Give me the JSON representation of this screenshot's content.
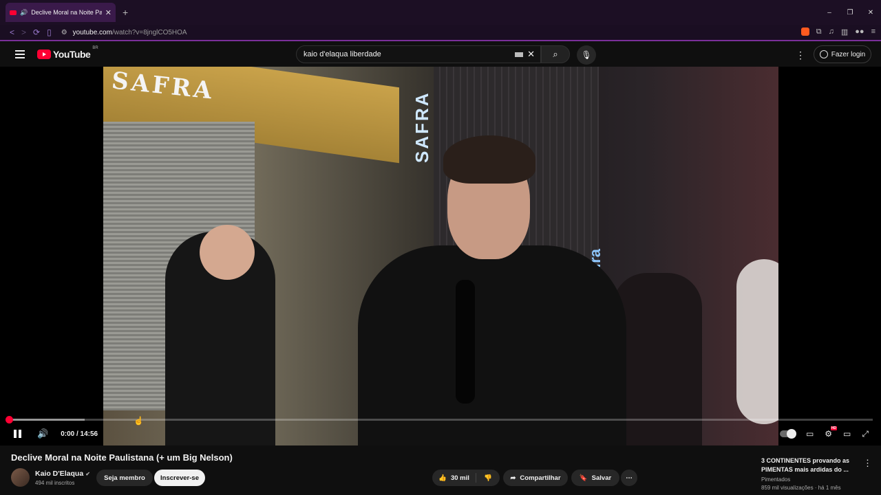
{
  "browser": {
    "tab_title": "Declive Moral na Noite Paulis",
    "new_tab": "+",
    "close_tab": "✕",
    "url_domain": "youtube.com",
    "url_path": "/watch?v=8jnglCO5HOA",
    "window_controls": [
      "–",
      "❐",
      "✕"
    ]
  },
  "header": {
    "logo_text": "YouTube",
    "logo_country": "BR",
    "search_value": "kaio d'elaqua liberdade",
    "login_label": "Fazer login"
  },
  "video": {
    "sign_top": "SAFRA",
    "sign_vertical": "SAFRA",
    "sign_vertical2": "Safra",
    "time": "0:00 / 14:56",
    "progress_fraction": 0.0,
    "buffered_fraction": 0.088
  },
  "info": {
    "title": "Declive Moral na Noite Paulistana (+ um Big Nelson)",
    "channel": "Kaio D'Elaqua",
    "subscribers": "494 mil inscritos",
    "member_label": "Seja membro",
    "subscribe_label": "Inscrever-se",
    "likes": "30 mil",
    "share_label": "Compartilhar",
    "save_label": "Salvar"
  },
  "recommendation": {
    "title": "3 CONTINENTES provando as PIMENTAS mais ardidas do ...",
    "channel": "Pimentados",
    "meta": "859 mil visualizações · há 1 mês"
  }
}
